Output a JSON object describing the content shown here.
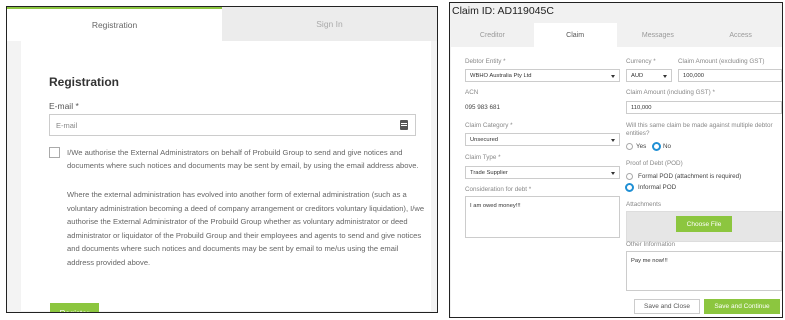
{
  "registration": {
    "tabs": [
      "Registration",
      "Sign In"
    ],
    "title": "Registration",
    "email_label": "E-mail *",
    "email_placeholder": "E-mail",
    "authorise_text": "I/We authorise the External Administrators on behalf of Probuild Group to send and give notices and documents where such notices and documents may be sent by email, by using the email address above.",
    "external_admin_text": "Where the external administration has evolved into another form of external administration (such as a voluntary administration becoming a deed of company arrangement or creditors voluntary liquidation), I/we authorise the External Administrator of the Probuild Group whether as voluntary administrator or deed administrator or liquidator of the Probuild Group and their employees and agents to send and give notices and documents where such notices and documents may be sent by email to me/us using the email address provided above.",
    "register_button": "Register",
    "accent_color": "#8cc63f"
  },
  "claim": {
    "title": "Claim ID: AD119045C",
    "tabs": [
      "Creditor",
      "Claim",
      "Messages",
      "Access"
    ],
    "active_tab": "Claim",
    "debtor_entity_label": "Debtor Entity *",
    "debtor_entity_value": "WBHO Australia Pty Ltd",
    "acn_label": "ACN",
    "acn_value": "095 983 681",
    "claim_category_label": "Claim Category *",
    "claim_category_value": "Unsecured",
    "claim_type_label": "Claim Type *",
    "claim_type_value": "Trade Supplier",
    "consideration_label": "Consideration for debt *",
    "consideration_value": "I am owed money!!!",
    "currency_label": "Currency *",
    "currency_value": "AUD",
    "claim_amount_label": "Claim Amount (excluding GST)",
    "claim_amount_value": "100,000",
    "claim_amount_incl_label": "Claim Amount (including GST) *",
    "claim_amount_incl_value": "110,000",
    "multiple_debtor_question": "Will this same claim be made against multiple debtor entities?",
    "yes_label": "Yes",
    "no_label": "No",
    "pod_label": "Proof of Debt (POD)",
    "formal_pod_label": "Formal POD (attachment is required)",
    "informal_pod_label": "Informal POD",
    "attachments_label": "Attachments",
    "choose_file_button": "Choose File",
    "other_info_label": "Other Information",
    "other_info_value": "Pay me now!!!",
    "save_close_button": "Save and Close",
    "save_continue_button": "Save and Continue"
  }
}
